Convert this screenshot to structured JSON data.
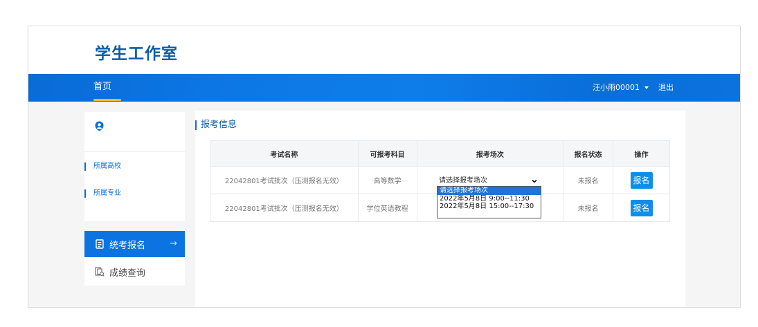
{
  "app": {
    "title": "学生工作室"
  },
  "nav": {
    "home": "首页",
    "user": "汪小雨00001",
    "logout": "退出"
  },
  "sidebar": {
    "info": [
      "所属高校",
      "所属专业"
    ],
    "menu": [
      {
        "label": "统考报名",
        "icon": "form-icon",
        "active": true
      },
      {
        "label": "成绩查询",
        "icon": "score-search-icon",
        "active": false
      }
    ]
  },
  "main": {
    "section_title": "报考信息",
    "columns": [
      "考试名称",
      "可报考科目",
      "报考场次",
      "报名状态",
      "操作"
    ],
    "rows": [
      {
        "exam": "22042801考试批次（压测报名无效）",
        "subject": "高等数学",
        "session": "请选择报考场次",
        "status": "未报名",
        "action": "报名"
      },
      {
        "exam": "22042801考试批次（压测报名无效）",
        "subject": "学位英语教程",
        "session": "",
        "status": "未报名",
        "action": "报名"
      }
    ],
    "session_dropdown": {
      "selected": "请选择报考场次",
      "options": [
        "请选择报考场次",
        "2022年5月8日 9:00--11:30",
        "2022年5月8日 15:00--17:30"
      ],
      "highlighted_index": 0
    }
  },
  "colors": {
    "nav_blue": "#0c78e6",
    "accent_yellow": "#f5b82e",
    "button_blue": "#0d8ee8",
    "title_blue": "#0b5ea8"
  }
}
